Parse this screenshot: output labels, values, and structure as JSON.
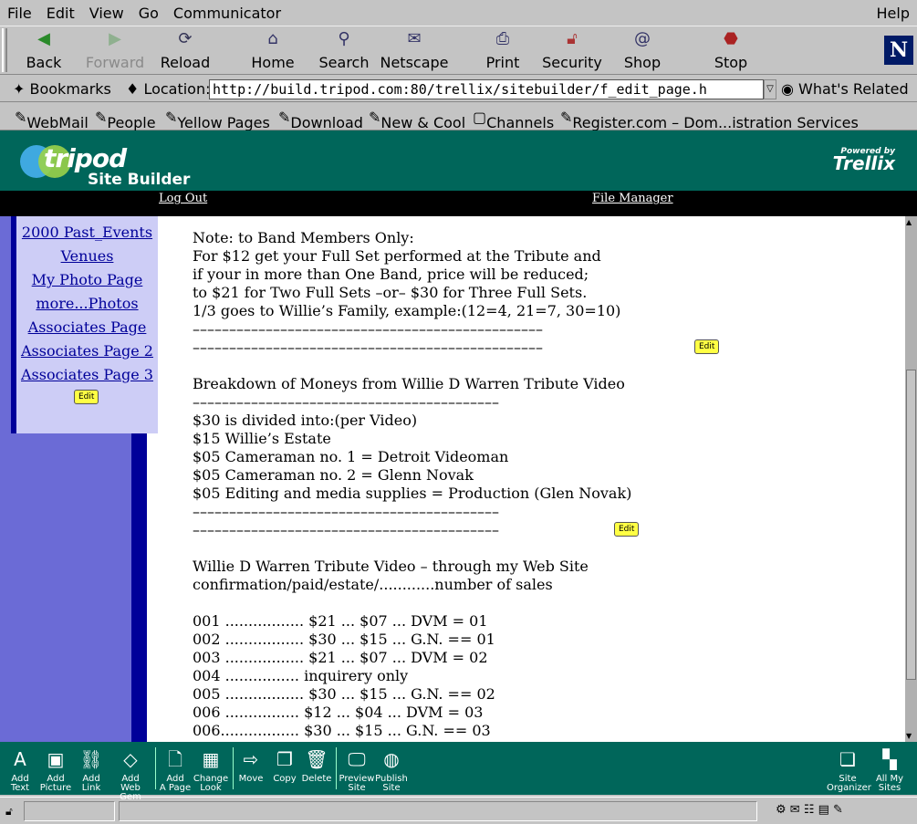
{
  "menu": {
    "file": "File",
    "edit": "Edit",
    "view": "View",
    "go": "Go",
    "communicator": "Communicator",
    "help": "Help"
  },
  "toolbar": {
    "back": "Back",
    "forward": "Forward",
    "reload": "Reload",
    "home": "Home",
    "search": "Search",
    "netscape": "Netscape",
    "print": "Print",
    "security": "Security",
    "shop": "Shop",
    "stop": "Stop"
  },
  "location": {
    "bookmarks": "Bookmarks",
    "label": "Location:",
    "url": "http://build.tripod.com:80/trellix/sitebuilder/f_edit_page.h",
    "related": "What's Related"
  },
  "links": {
    "webmail": "WebMail",
    "people": "People",
    "yellow_pages": "Yellow Pages",
    "download": "Download",
    "new_cool": "New & Cool",
    "channels": "Channels",
    "register": "Register.com – Dom...istration Services"
  },
  "header": {
    "logo": "tripod",
    "builder": "Site Builder",
    "powered": "Powered by",
    "trellix": "Trellix"
  },
  "blackbar": {
    "logout": "Log Out",
    "file_manager": "File Manager"
  },
  "nav": {
    "links": [
      "2000 Past_Events",
      "Venues",
      "My Photo Page",
      "more...Photos",
      "Associates Page",
      "Associates Page 2",
      "Associates Page 3"
    ],
    "edit": "Edit"
  },
  "main": {
    "block1": [
      "Note: to Band Members Only:",
      "For $12 get your Full Set performed at the Tribute and",
      "if your in more than One Band, price will be reduced;",
      "to $21 for Two Full Sets –or– $30 for Three Full Sets.",
      "1/3 goes to Willie’s Family, example:(12=4, 21=7, 30=10)",
      "––––––––––––––––––––––––––––––––––––––––––––––––",
      "––––––––––––––––––––––––––––––––––––––––––––––––"
    ],
    "edit": "Edit",
    "block2": [
      "Breakdown of Moneys from Willie D Warren Tribute Video",
      "––––––––––––––––––––––––––––––––––––––––––",
      "$30 is divided into:(per Video)",
      "$15 Willie’s Estate",
      "$05 Cameraman no. 1 = Detroit Videoman",
      "$05 Cameraman no. 2 = Glenn Novak",
      "$05 Editing and media supplies = Production (Glen Novak)",
      "––––––––––––––––––––––––––––––––––––––––––",
      "––––––––––––––––––––––––––––––––––––––––––"
    ],
    "block3": [
      "Willie D Warren Tribute Video – through my Web Site",
      "confirmation/paid/estate/............number of sales",
      "",
      "001 ................. $21 ... $07 ... DVM = 01",
      "002 ................. $30 ... $15 ... G.N. == 01",
      "003 ................. $21 ... $07 ... DVM = 02",
      "004 ................ inquirery only",
      "005 ................. $30 ... $15 ... G.N. == 02",
      "006 ................ $12 ... $04 ... DVM = 03",
      "006................. $30 ... $15 ... G.N. == 03"
    ]
  },
  "bottom": {
    "add_text": [
      "Add",
      "Text"
    ],
    "add_picture": [
      "Add",
      "Picture"
    ],
    "add_link": [
      "Add",
      "Link"
    ],
    "add_web_gem": [
      "Add",
      "Web Gem"
    ],
    "add_page": [
      "Add",
      "A Page"
    ],
    "change_look": [
      "Change",
      "Look"
    ],
    "move": [
      "Move",
      ""
    ],
    "copy": [
      "Copy",
      ""
    ],
    "delete": [
      "Delete",
      ""
    ],
    "preview": [
      "Preview",
      "Site"
    ],
    "publish": [
      "Publish",
      "Site"
    ],
    "organizer": [
      "Site",
      "Organizer"
    ],
    "all_sites": [
      "All My",
      "Sites"
    ]
  }
}
